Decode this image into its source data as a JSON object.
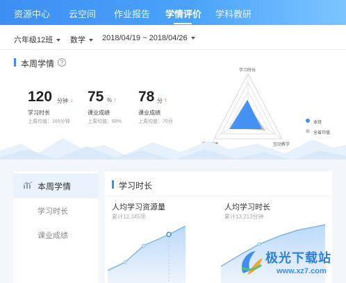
{
  "nav": {
    "items": [
      {
        "label": "资源中心"
      },
      {
        "label": "云空间"
      },
      {
        "label": "作业报告"
      },
      {
        "label": "学情评价"
      },
      {
        "label": "学科教研"
      }
    ],
    "active_index": 3
  },
  "filters": {
    "class": "六年级12班",
    "subject": "数学",
    "date_range": "2018/04/19 ~ 2018/04/26"
  },
  "weekly": {
    "title": "本周学情",
    "help_symbol": "?",
    "stats": [
      {
        "value": "120",
        "unit": "分钟",
        "trend_symbol": "↓",
        "label": "学习时长",
        "avg": "上周均值：165分钟"
      },
      {
        "value": "75",
        "unit": "%",
        "trend_symbol": "↑",
        "label": "课业成绩",
        "avg": "上周均值：68%"
      },
      {
        "value": "78",
        "unit": "分",
        "trend_symbol": "↑",
        "label": "课业成绩",
        "avg": "上周均值：70分"
      }
    ]
  },
  "radar": {
    "axes": [
      "学习时长",
      "课业成绩",
      "互动教学"
    ],
    "legend": [
      {
        "label": "本班",
        "color": "#3d8ef3"
      },
      {
        "label": "全省均值",
        "color": "#c8c8c8"
      }
    ]
  },
  "sidebar": {
    "items": [
      {
        "label": "本周学情"
      },
      {
        "label": "学习时长"
      },
      {
        "label": "课业成绩"
      }
    ]
  },
  "panel": {
    "title": "学习时长",
    "left": {
      "title": "人均学习资源量",
      "caption": "累计12,345项"
    },
    "right": {
      "title": "人均学习时长",
      "caption": "累计13,213分钟"
    }
  },
  "watermark": {
    "name": "极光下载站",
    "url": "www.xz7.com"
  },
  "colors": {
    "accent": "#3d8ef3",
    "down": "#22b07d",
    "up": "#f0603f"
  }
}
